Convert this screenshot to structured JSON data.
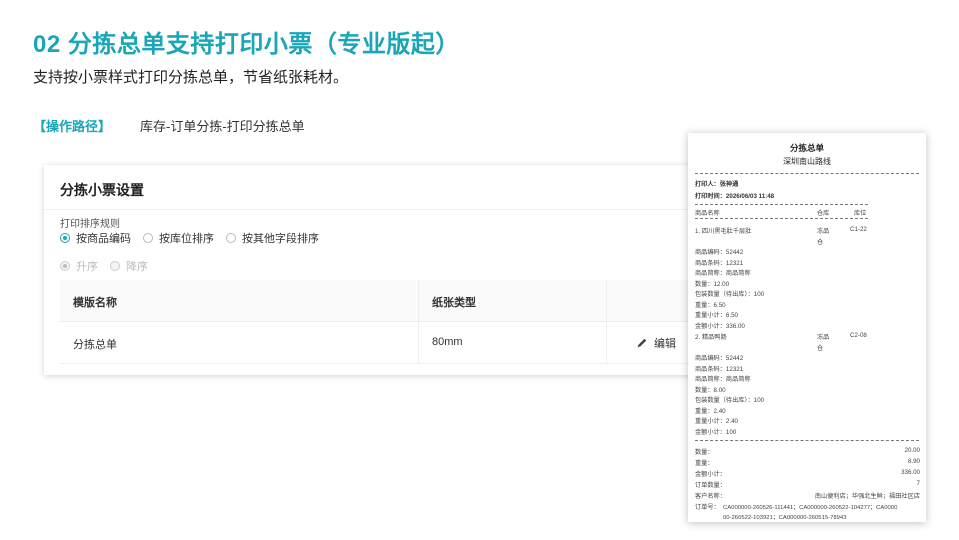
{
  "header": {
    "title": "02  分拣总单支持打印小票（专业版起）",
    "subtitle": "支持按小票样式打印分拣总单，节省纸张耗材。",
    "path_tag": "【操作路径】",
    "path_text": "库存-订单分拣-打印分拣总单"
  },
  "settings": {
    "title": "分拣小票设置",
    "sort_label": "打印排序规则",
    "sort_options": [
      {
        "label": "按商品编码",
        "selected": true
      },
      {
        "label": "按库位排序",
        "selected": false
      },
      {
        "label": "按其他字段排序",
        "selected": false
      }
    ],
    "order_options": [
      {
        "label": "升序",
        "selected": true
      },
      {
        "label": "降序",
        "selected": false
      }
    ],
    "table": {
      "columns": [
        "模版名称",
        "纸张类型",
        ""
      ],
      "rows": [
        {
          "name": "分拣总单",
          "paper": "80mm",
          "action": "编辑"
        }
      ]
    }
  },
  "receipt": {
    "title": "分拣总单",
    "store": "深圳南山路线",
    "printer": "打印人：张神通",
    "print_time": "打印时间：2026/06/03 11:48",
    "col_name": "商品名称",
    "col_warehouse": "仓库",
    "col_location": "库位",
    "items": [
      {
        "name": "1. 四川黑毛肚千层肚",
        "warehouse": [
          "冻品",
          "仓"
        ],
        "location": "C1-22",
        "lines": [
          "商品编码：52442",
          "商品条码：12321",
          "商品简称：商品简称",
          "数量：12.00",
          "包装数量（待出库）：100",
          "重量：6.50",
          "重量小计：6.50",
          "金额小计：336.00"
        ]
      },
      {
        "name": "2. 精品鸭肠",
        "warehouse": [
          "冻品",
          "仓"
        ],
        "location": "C2-08",
        "lines": [
          "商品编码：52442",
          "商品条码：12321",
          "商品简称：商品简称",
          "数量：8.00",
          "包装数量（待出库）：100",
          "重量：2.40",
          "重量小计：2.40",
          "金额小计：100"
        ]
      }
    ],
    "summary": [
      {
        "label": "数量：",
        "value": "20.00"
      },
      {
        "label": "重量：",
        "value": "8.90"
      },
      {
        "label": "金额小计：",
        "value": "336.00"
      },
      {
        "label": "订单数量：",
        "value": "7"
      },
      {
        "label": "客户名称：",
        "value": "南山便利店；华强北生鲜；福田社区店"
      }
    ],
    "order_label": "订单号：",
    "order_line1": "CA000000-260526-111441；CA000000-260522-104277；CA0000",
    "order_line2": "00-260522-103921；CA000000-260515-78943"
  },
  "colors": {
    "accent": "#1aa6b7"
  },
  "icons": {
    "edit": "pencil-icon"
  }
}
